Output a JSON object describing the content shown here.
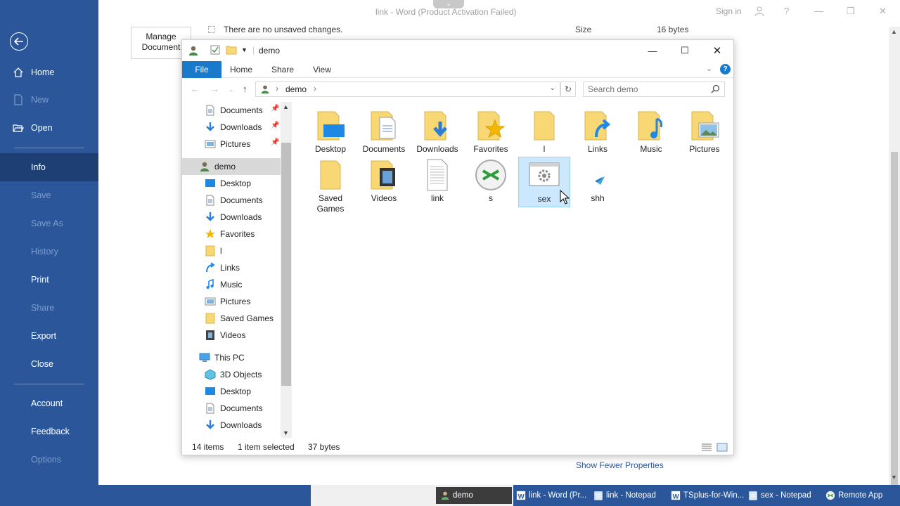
{
  "word": {
    "title": "link  -  Word (Product Activation Failed)",
    "signin": "Sign in",
    "backstage": [
      {
        "label": "Home",
        "state": "normal"
      },
      {
        "label": "New",
        "state": "disabled"
      },
      {
        "label": "Open",
        "state": "normal"
      },
      {
        "label": "Info",
        "state": "active"
      },
      {
        "label": "Save",
        "state": "disabled"
      },
      {
        "label": "Save As",
        "state": "disabled"
      },
      {
        "label": "History",
        "state": "disabled"
      },
      {
        "label": "Print",
        "state": "normal"
      },
      {
        "label": "Share",
        "state": "disabled"
      },
      {
        "label": "Export",
        "state": "normal"
      },
      {
        "label": "Close",
        "state": "normal"
      },
      {
        "label": "Account",
        "state": "normal"
      },
      {
        "label": "Feedback",
        "state": "normal"
      },
      {
        "label": "Options",
        "state": "disabled"
      }
    ],
    "manage_document": "Manage Document",
    "unsaved_text": "There are no unsaved changes.",
    "size_label": "Size",
    "size_value": "16 bytes",
    "show_fewer": "Show Fewer Properties"
  },
  "explorer": {
    "title": "demo",
    "ribbon_tabs": [
      "File",
      "Home",
      "Share",
      "View"
    ],
    "breadcrumb": "demo",
    "search_placeholder": "Search demo",
    "nav": {
      "quick_access": [
        "Documents",
        "Downloads",
        "Pictures"
      ],
      "user": "demo",
      "user_children": [
        "Desktop",
        "Documents",
        "Downloads",
        "Favorites",
        "l",
        "Links",
        "Music",
        "Pictures",
        "Saved Games",
        "Videos"
      ],
      "this_pc": "This PC",
      "pc_children": [
        "3D Objects",
        "Desktop",
        "Documents",
        "Downloads"
      ]
    },
    "files": [
      {
        "name": "Desktop",
        "icon": "folder-desktop-icon"
      },
      {
        "name": "Documents",
        "icon": "folder-documents-icon"
      },
      {
        "name": "Downloads",
        "icon": "folder-downloads-icon"
      },
      {
        "name": "Favorites",
        "icon": "folder-favorites-icon"
      },
      {
        "name": "l",
        "icon": "folder-icon"
      },
      {
        "name": "Links",
        "icon": "folder-links-icon"
      },
      {
        "name": "Music",
        "icon": "folder-music-icon"
      },
      {
        "name": "Pictures",
        "icon": "folder-pictures-icon"
      },
      {
        "name": "Saved Games",
        "icon": "folder-icon"
      },
      {
        "name": "Videos",
        "icon": "folder-videos-icon"
      },
      {
        "name": "link",
        "icon": "text-file-icon"
      },
      {
        "name": "s",
        "icon": "remote-app-icon"
      },
      {
        "name": "sex",
        "icon": "settings-file-icon"
      },
      {
        "name": "shh",
        "icon": "shortcut-icon"
      }
    ],
    "status": {
      "count": "14 items",
      "selected": "1 item selected",
      "size": "37 bytes"
    }
  },
  "taskbar": {
    "items": [
      "demo",
      "link - Word (Pr...",
      "link - Notepad",
      "TSplus-for-Win...",
      "sex - Notepad",
      "Remote App"
    ]
  }
}
